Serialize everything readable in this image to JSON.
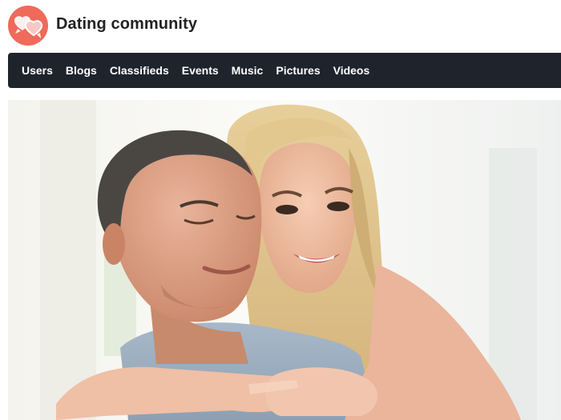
{
  "header": {
    "site_name": "Dating community",
    "logo_icon": "hearts-chat-icon",
    "logo_color": "#ef6a5b"
  },
  "nav": {
    "items": [
      {
        "label": "Users"
      },
      {
        "label": "Blogs"
      },
      {
        "label": "Classifieds"
      },
      {
        "label": "Events"
      },
      {
        "label": "Music"
      },
      {
        "label": "Pictures"
      },
      {
        "label": "Videos"
      }
    ],
    "background": "#1f232c"
  },
  "hero": {
    "subject": "couple embracing"
  }
}
